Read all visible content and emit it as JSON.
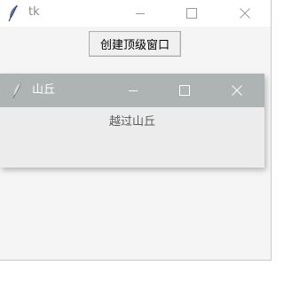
{
  "main_window": {
    "title": "tk",
    "create_button_label": "创建顶级窗口",
    "icons": [
      "feather-icon",
      "minimize-icon",
      "maximize-icon",
      "close-icon"
    ]
  },
  "top_window": {
    "title": "山丘",
    "label": "越过山丘",
    "icons": [
      "feather-icon",
      "minimize-icon",
      "maximize-icon",
      "close-icon"
    ]
  },
  "colors": {
    "top_titlebar": "#aeb3b4",
    "main_background": "#f5f5f5",
    "top_background": "#ececec"
  }
}
